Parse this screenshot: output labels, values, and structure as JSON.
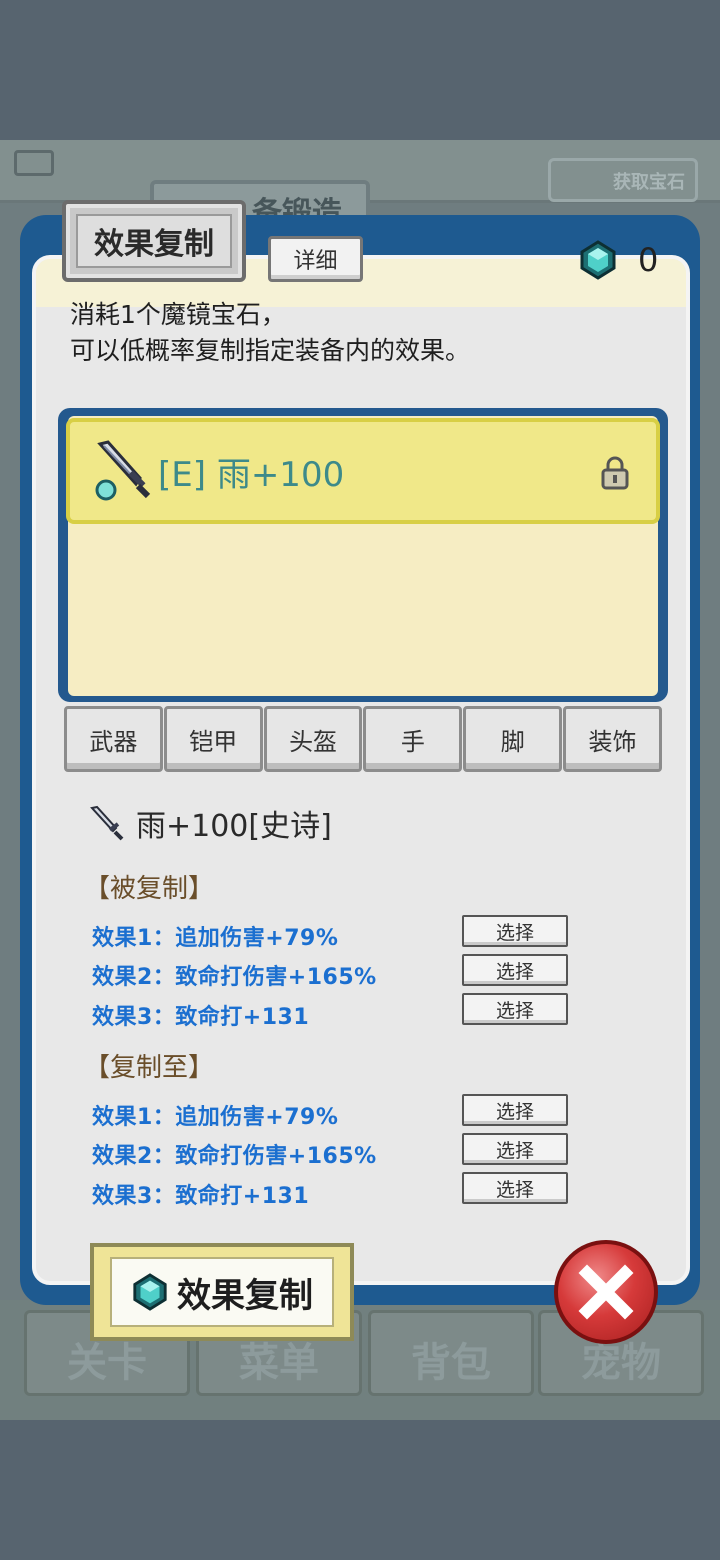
{
  "background": {
    "forge_tab_text": "备锻造",
    "get_gems_text": "获取宝石",
    "bottom_nav": [
      "关卡",
      "菜单",
      "背包",
      "宠物"
    ]
  },
  "dialog": {
    "title": "效果复制",
    "detail_label": "详细",
    "gem_count": "0",
    "description_line1": "消耗1个魔镜宝石，",
    "description_line2": "可以低概率复制指定装备内的效果。",
    "selected_equipment_label": "[E] 雨+100",
    "category_tabs": [
      "武器",
      "铠甲",
      "头盔",
      "手",
      "脚",
      "装饰"
    ],
    "item_name": "雨+100[史诗]",
    "source_section": {
      "title": "【被复制】",
      "effects": [
        {
          "text": "效果1：追加伤害+79%",
          "button": "选择"
        },
        {
          "text": "效果2：致命打伤害+165%",
          "button": "选择"
        },
        {
          "text": "效果3：致命打+131",
          "button": "选择"
        }
      ]
    },
    "target_section": {
      "title": "【复制至】",
      "effects": [
        {
          "text": "效果1：追加伤害+79%",
          "button": "选择"
        },
        {
          "text": "效果2：致命打伤害+165%",
          "button": "选择"
        },
        {
          "text": "效果3：致命打+131",
          "button": "选择"
        }
      ]
    },
    "copy_button_label": "效果复制"
  },
  "colors": {
    "panel_frame": "#1e5a90",
    "effect_text": "#1b6fd0",
    "selected_row": "#f0e889"
  }
}
